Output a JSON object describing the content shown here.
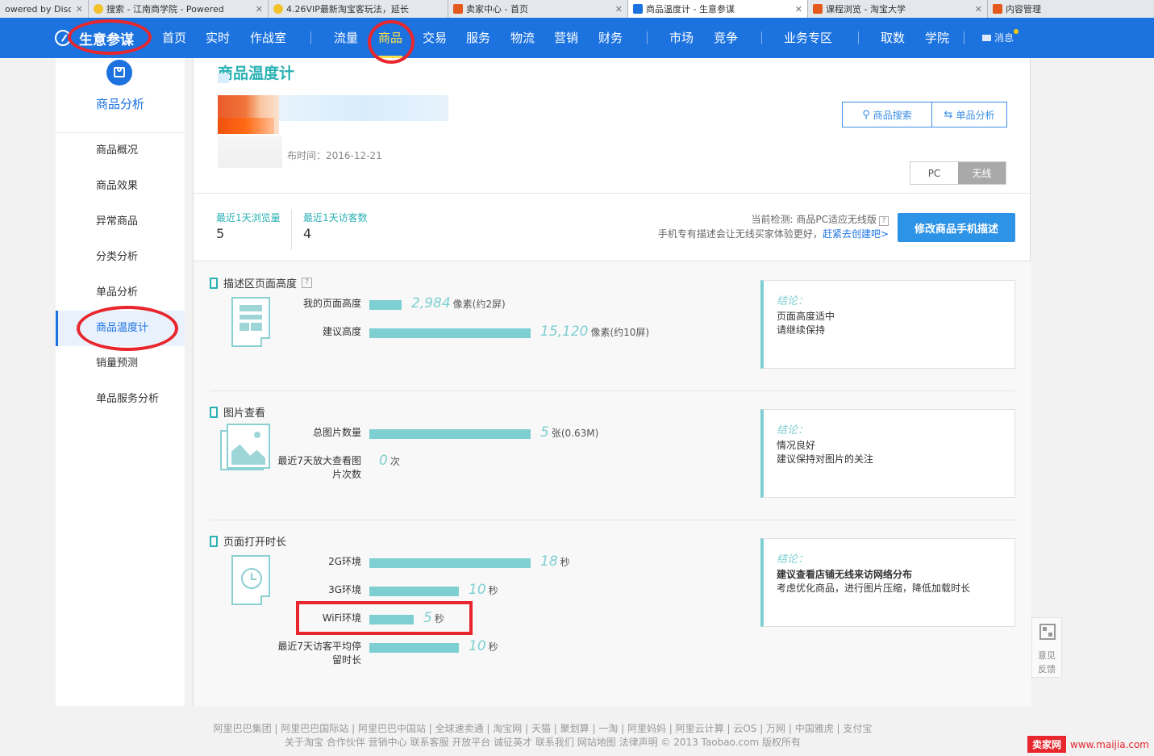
{
  "browser": {
    "tabs": [
      {
        "title": "owered by Disc",
        "active": false,
        "color": "#9aa3ad"
      },
      {
        "title": "搜索 - 江南商学院 - Powered",
        "active": false,
        "color": "#f3c12c"
      },
      {
        "title": "4.26VIP最新淘宝客玩法，延长",
        "active": false,
        "color": "#f3c12c"
      },
      {
        "title": "卖家中心 - 首页",
        "active": false,
        "color": "#e35a1c"
      },
      {
        "title": "商品温度计 - 生意参谋",
        "active": true,
        "color": "#1c73e0"
      },
      {
        "title": "课程浏览 - 淘宝大学",
        "active": false,
        "color": "#e35a1c"
      },
      {
        "title": "内容管理",
        "active": false,
        "color": "#e35a1c"
      }
    ]
  },
  "nav": {
    "brand": "生意参谋",
    "items": [
      "首页",
      "实时",
      "作战室",
      "流量",
      "商品",
      "交易",
      "服务",
      "物流",
      "营销",
      "财务",
      "市场",
      "竞争",
      "业务专区",
      "取数",
      "学院"
    ],
    "active": "商品",
    "message": "消息"
  },
  "sidebar": {
    "title": "商品分析",
    "items": [
      "商品概况",
      "商品效果",
      "异常商品",
      "分类分析",
      "单品分析",
      "商品温度计",
      "销量预测",
      "单品服务分析"
    ],
    "active": "商品温度计"
  },
  "header": {
    "page_title": "商品温度计",
    "publish_time": "布时间：2016-12-21",
    "search_button": "商品搜索",
    "single_button": "单品分析",
    "toggle": {
      "pc": "PC",
      "wireless": "无线",
      "active": "无线"
    }
  },
  "stats": [
    {
      "label": "最近1天浏览量",
      "value": "5"
    },
    {
      "label": "最近1天访客数",
      "value": "4"
    }
  ],
  "detection": {
    "line1": "当前检测: 商品PC适应无线版",
    "line2_prefix": "手机专有描述会让无线买家体验更好，",
    "line2_link": "赶紧去创建吧>",
    "button": "修改商品手机描述"
  },
  "sections": [
    {
      "title": "描述区页面高度",
      "metrics": [
        {
          "label": "我的页面高度",
          "value": "2,984",
          "unit": "像素(约2屏)",
          "fraction": 0.198
        },
        {
          "label": "建议高度",
          "value": "15,120",
          "unit": "像素(约10屏)",
          "fraction": 1.0
        }
      ],
      "conclusion": {
        "label": "结论：",
        "lines": [
          "页面高度适中",
          "请继续保持"
        ]
      }
    },
    {
      "title": "图片查看",
      "metrics": [
        {
          "label": "总图片数量",
          "value": "5",
          "unit": "张(0.63M)",
          "fraction": 1.0
        },
        {
          "label": "最近7天放大查看图片次数",
          "value": "0",
          "unit": "次",
          "fraction": 0
        }
      ],
      "conclusion": {
        "label": "结论：",
        "lines": [
          "情况良好",
          "建议保持对图片的关注"
        ]
      }
    },
    {
      "title": "页面打开时长",
      "metrics": [
        {
          "label": "2G环境",
          "value": "18",
          "unit": "秒",
          "fraction": 1.0
        },
        {
          "label": "3G环境",
          "value": "10",
          "unit": "秒",
          "fraction": 0.555
        },
        {
          "label": "WiFi环境",
          "value": "5",
          "unit": "秒",
          "fraction": 0.275
        },
        {
          "label": "最近7天访客平均停留时长",
          "value": "10",
          "unit": "秒",
          "fraction": 0.555
        }
      ],
      "conclusion": {
        "label": "结论：",
        "lines": [
          "建议查看店铺无线来访网络分布",
          "考虑优化商品，进行图片压缩，降低加载时长"
        ]
      }
    }
  ],
  "feedback": {
    "line1": "意见",
    "line2": "反馈"
  },
  "footer": {
    "line1": "阿里巴巴集团 | 阿里巴巴国际站 | 阿里巴巴中国站 | 全球速卖通 | 淘宝网 | 天猫 | 聚划算 | 一淘 | 阿里妈妈 | 阿里云计算 | 云OS | 万网 | 中国雅虎 | 支付宝",
    "line2": "关于淘宝 合作伙伴 营销中心 联系客服 开放平台 诚征英才 联系我们 网站地图 法律声明 © 2013 Taobao.com 版权所有"
  },
  "watermark": {
    "brand": "卖家网",
    "url": "www.maijia.com"
  },
  "colors": {
    "nav_blue": "#1c73e0",
    "teal": "#2ab1b4",
    "bar": "#7ecfd1",
    "annotation_red": "#e8262d"
  }
}
